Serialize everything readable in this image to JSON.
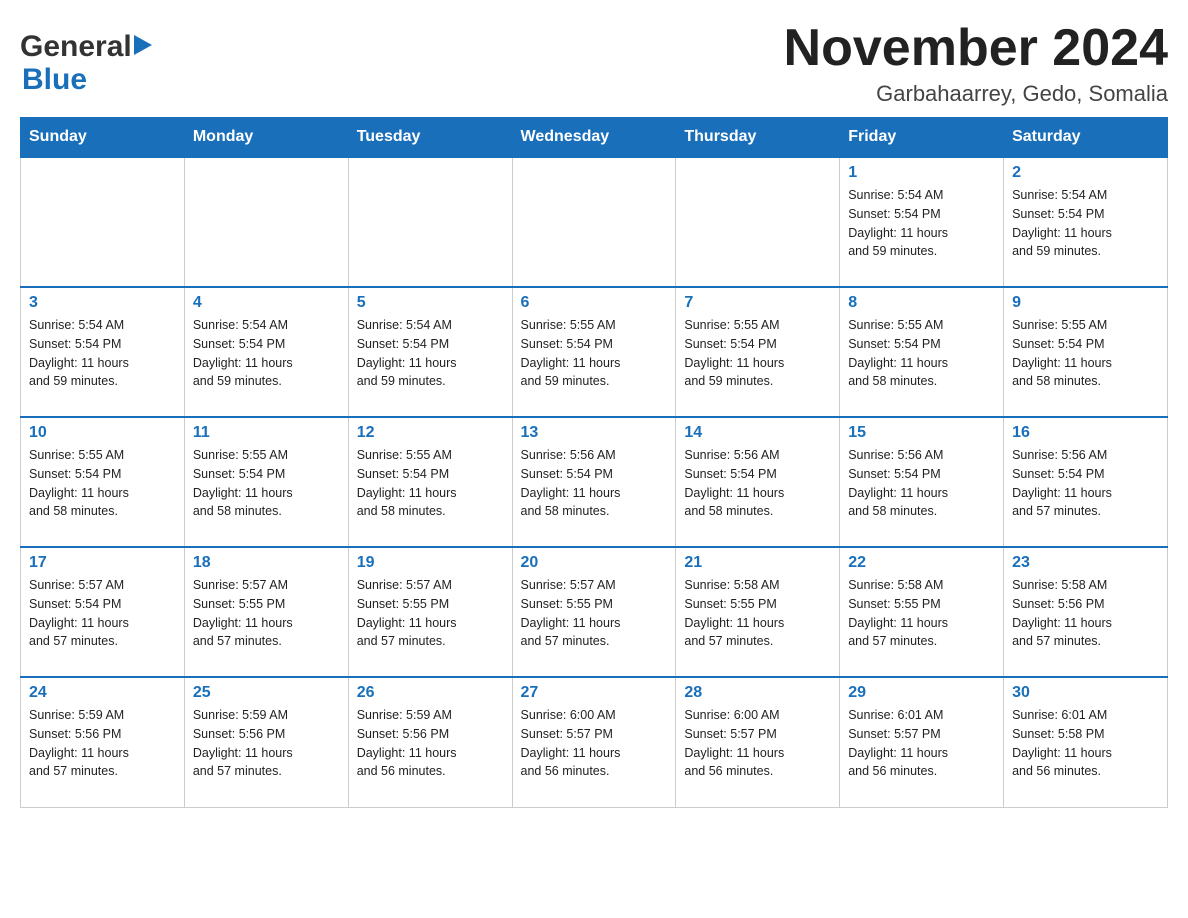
{
  "header": {
    "logo_general": "General",
    "logo_blue": "Blue",
    "month_title": "November 2024",
    "location": "Garbahaarrey, Gedo, Somalia"
  },
  "weekdays": [
    "Sunday",
    "Monday",
    "Tuesday",
    "Wednesday",
    "Thursday",
    "Friday",
    "Saturday"
  ],
  "weeks": [
    [
      {
        "day": "",
        "info": ""
      },
      {
        "day": "",
        "info": ""
      },
      {
        "day": "",
        "info": ""
      },
      {
        "day": "",
        "info": ""
      },
      {
        "day": "",
        "info": ""
      },
      {
        "day": "1",
        "info": "Sunrise: 5:54 AM\nSunset: 5:54 PM\nDaylight: 11 hours\nand 59 minutes."
      },
      {
        "day": "2",
        "info": "Sunrise: 5:54 AM\nSunset: 5:54 PM\nDaylight: 11 hours\nand 59 minutes."
      }
    ],
    [
      {
        "day": "3",
        "info": "Sunrise: 5:54 AM\nSunset: 5:54 PM\nDaylight: 11 hours\nand 59 minutes."
      },
      {
        "day": "4",
        "info": "Sunrise: 5:54 AM\nSunset: 5:54 PM\nDaylight: 11 hours\nand 59 minutes."
      },
      {
        "day": "5",
        "info": "Sunrise: 5:54 AM\nSunset: 5:54 PM\nDaylight: 11 hours\nand 59 minutes."
      },
      {
        "day": "6",
        "info": "Sunrise: 5:55 AM\nSunset: 5:54 PM\nDaylight: 11 hours\nand 59 minutes."
      },
      {
        "day": "7",
        "info": "Sunrise: 5:55 AM\nSunset: 5:54 PM\nDaylight: 11 hours\nand 59 minutes."
      },
      {
        "day": "8",
        "info": "Sunrise: 5:55 AM\nSunset: 5:54 PM\nDaylight: 11 hours\nand 58 minutes."
      },
      {
        "day": "9",
        "info": "Sunrise: 5:55 AM\nSunset: 5:54 PM\nDaylight: 11 hours\nand 58 minutes."
      }
    ],
    [
      {
        "day": "10",
        "info": "Sunrise: 5:55 AM\nSunset: 5:54 PM\nDaylight: 11 hours\nand 58 minutes."
      },
      {
        "day": "11",
        "info": "Sunrise: 5:55 AM\nSunset: 5:54 PM\nDaylight: 11 hours\nand 58 minutes."
      },
      {
        "day": "12",
        "info": "Sunrise: 5:55 AM\nSunset: 5:54 PM\nDaylight: 11 hours\nand 58 minutes."
      },
      {
        "day": "13",
        "info": "Sunrise: 5:56 AM\nSunset: 5:54 PM\nDaylight: 11 hours\nand 58 minutes."
      },
      {
        "day": "14",
        "info": "Sunrise: 5:56 AM\nSunset: 5:54 PM\nDaylight: 11 hours\nand 58 minutes."
      },
      {
        "day": "15",
        "info": "Sunrise: 5:56 AM\nSunset: 5:54 PM\nDaylight: 11 hours\nand 58 minutes."
      },
      {
        "day": "16",
        "info": "Sunrise: 5:56 AM\nSunset: 5:54 PM\nDaylight: 11 hours\nand 57 minutes."
      }
    ],
    [
      {
        "day": "17",
        "info": "Sunrise: 5:57 AM\nSunset: 5:54 PM\nDaylight: 11 hours\nand 57 minutes."
      },
      {
        "day": "18",
        "info": "Sunrise: 5:57 AM\nSunset: 5:55 PM\nDaylight: 11 hours\nand 57 minutes."
      },
      {
        "day": "19",
        "info": "Sunrise: 5:57 AM\nSunset: 5:55 PM\nDaylight: 11 hours\nand 57 minutes."
      },
      {
        "day": "20",
        "info": "Sunrise: 5:57 AM\nSunset: 5:55 PM\nDaylight: 11 hours\nand 57 minutes."
      },
      {
        "day": "21",
        "info": "Sunrise: 5:58 AM\nSunset: 5:55 PM\nDaylight: 11 hours\nand 57 minutes."
      },
      {
        "day": "22",
        "info": "Sunrise: 5:58 AM\nSunset: 5:55 PM\nDaylight: 11 hours\nand 57 minutes."
      },
      {
        "day": "23",
        "info": "Sunrise: 5:58 AM\nSunset: 5:56 PM\nDaylight: 11 hours\nand 57 minutes."
      }
    ],
    [
      {
        "day": "24",
        "info": "Sunrise: 5:59 AM\nSunset: 5:56 PM\nDaylight: 11 hours\nand 57 minutes."
      },
      {
        "day": "25",
        "info": "Sunrise: 5:59 AM\nSunset: 5:56 PM\nDaylight: 11 hours\nand 57 minutes."
      },
      {
        "day": "26",
        "info": "Sunrise: 5:59 AM\nSunset: 5:56 PM\nDaylight: 11 hours\nand 56 minutes."
      },
      {
        "day": "27",
        "info": "Sunrise: 6:00 AM\nSunset: 5:57 PM\nDaylight: 11 hours\nand 56 minutes."
      },
      {
        "day": "28",
        "info": "Sunrise: 6:00 AM\nSunset: 5:57 PM\nDaylight: 11 hours\nand 56 minutes."
      },
      {
        "day": "29",
        "info": "Sunrise: 6:01 AM\nSunset: 5:57 PM\nDaylight: 11 hours\nand 56 minutes."
      },
      {
        "day": "30",
        "info": "Sunrise: 6:01 AM\nSunset: 5:58 PM\nDaylight: 11 hours\nand 56 minutes."
      }
    ]
  ]
}
